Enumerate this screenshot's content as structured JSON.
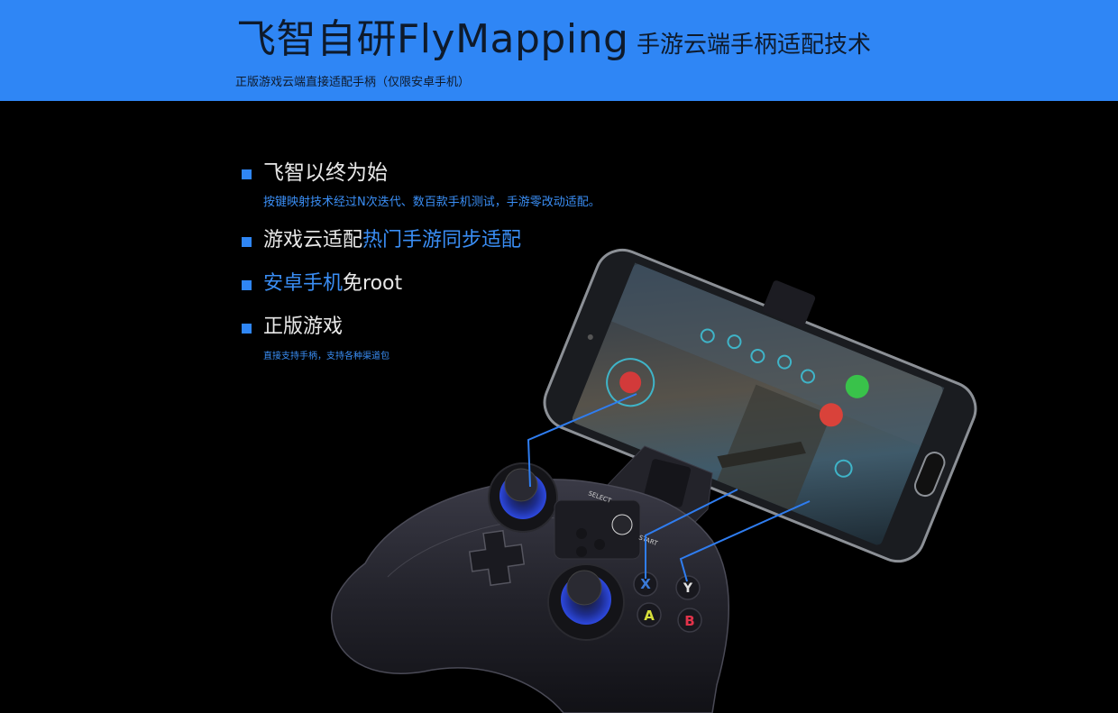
{
  "banner": {
    "title": "飞智自研FlyMapping",
    "subtitle": "手游云端手柄适配技术",
    "tagline": "正版游戏云端直接适配手柄（仅限安卓手机）"
  },
  "features": [
    {
      "title": "飞智以终为始",
      "desc": "按键映射技术经过N次迭代、数百款手机测试，手游零改动适配。"
    },
    {
      "title_plain": "游戏云适配",
      "title_accent": "热门手游同步适配"
    },
    {
      "title_accent": "安卓手机",
      "title_plain": "免root"
    },
    {
      "title": "正版游戏",
      "desc": "直接支持手柄，支持各种渠道包"
    }
  ],
  "controller": {
    "select_label": "SELECT",
    "start_label": "START",
    "buttons": {
      "x": "X",
      "y": "Y",
      "a": "A",
      "b": "B"
    }
  },
  "colors": {
    "banner": "#2f86f5",
    "accent": "#3a8ef5",
    "background": "#000000"
  }
}
